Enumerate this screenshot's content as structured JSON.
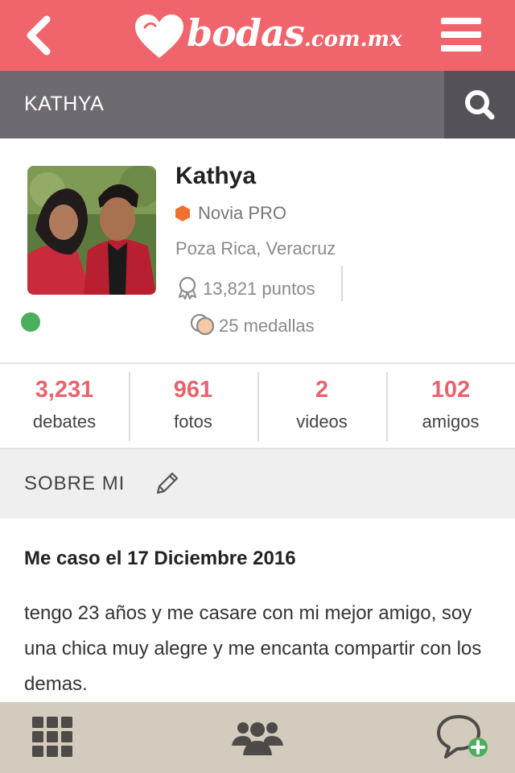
{
  "header": {
    "logo_text": "bodas",
    "logo_tld": ".com.mx"
  },
  "titlebar": {
    "title": "KATHYA"
  },
  "profile": {
    "name": "Kathya",
    "badge": "Novia PRO",
    "location": "Poza Rica, Veracruz",
    "points": "13,821 puntos",
    "medals": "25 medallas",
    "status": "online"
  },
  "stats": [
    {
      "value": "3,231",
      "label": "debates"
    },
    {
      "value": "961",
      "label": "fotos"
    },
    {
      "value": "2",
      "label": "videos"
    },
    {
      "value": "102",
      "label": "amigos"
    }
  ],
  "about": {
    "section_title": "SOBRE MI",
    "wedding_date": "Me caso el 17 Diciembre 2016",
    "bio": "tengo 23 años y me casare con mi mejor amigo, soy una chica muy alegre y me encanta compartir con los demas."
  },
  "icons": {
    "back": "chevron-left-icon",
    "menu": "hamburger-menu-icon",
    "search": "search-icon",
    "edit": "pencil-icon",
    "points": "award-ribbon-icon",
    "medals": "medal-icon",
    "nav_grid": "grid-icon",
    "nav_community": "people-icon",
    "nav_new_post": "chat-add-icon"
  },
  "colors": {
    "brand": "#f0646c",
    "titlebar": "#6f6a72",
    "search_bg": "#565159",
    "stat_value": "#e8646c",
    "pro_badge": "#f07030",
    "online": "#4caf5d",
    "bottom_nav": "#d3cbbd"
  }
}
